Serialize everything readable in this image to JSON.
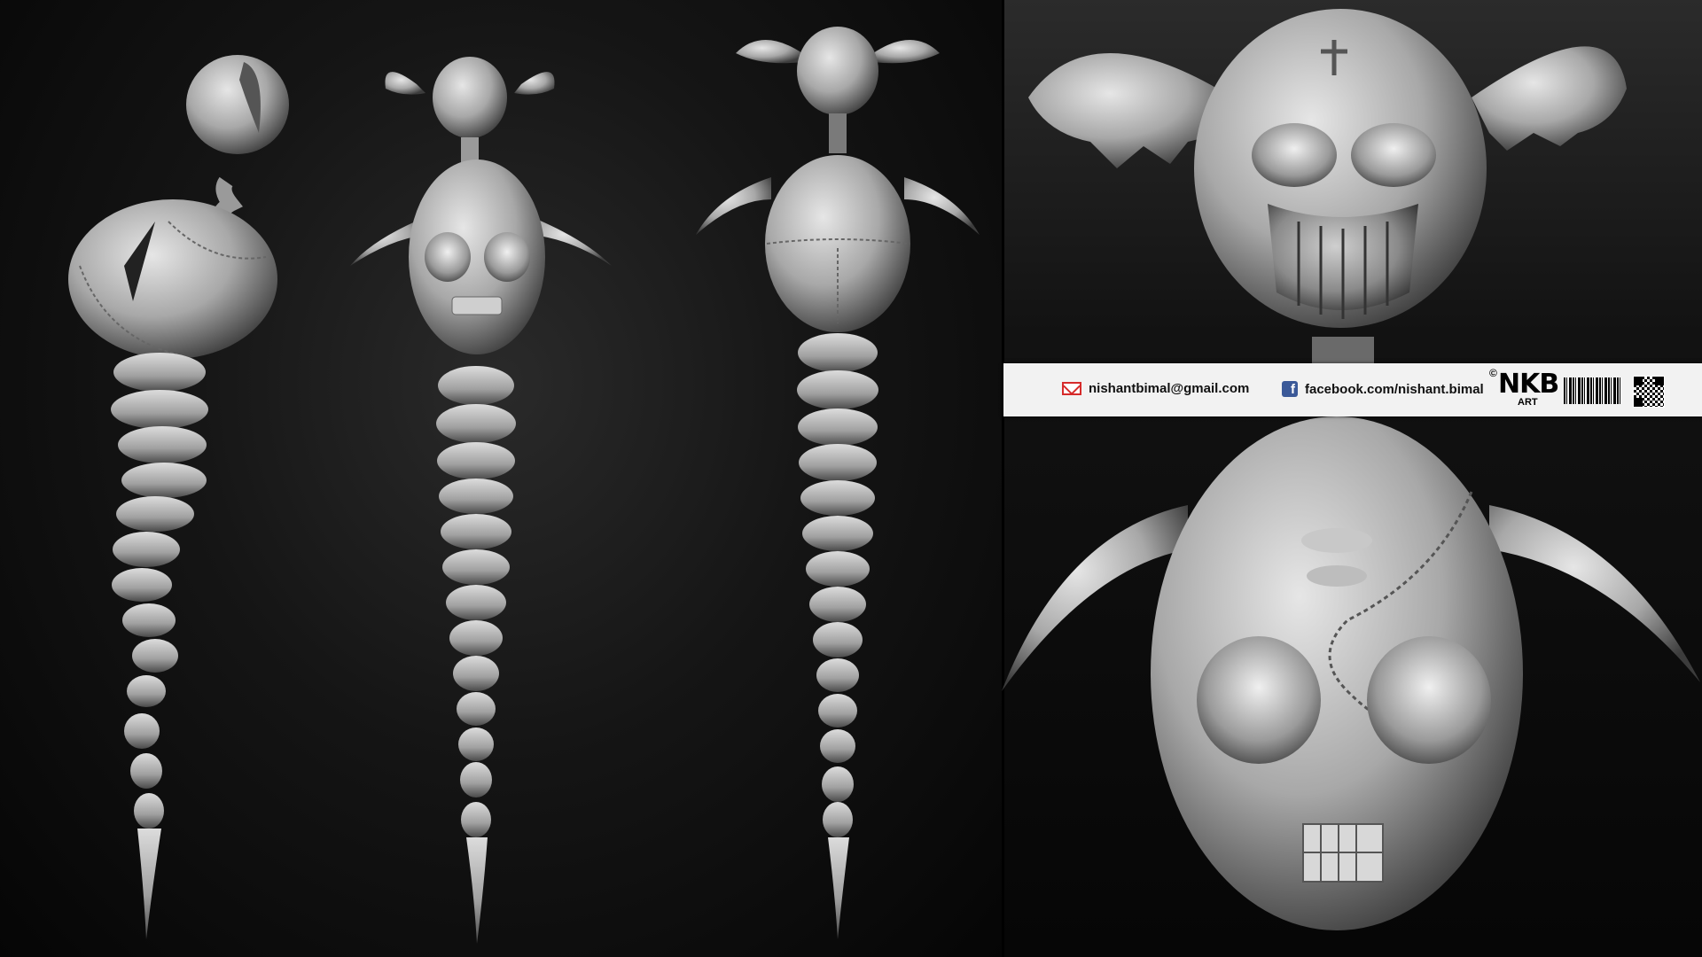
{
  "banner": {
    "email": "nishantbimal@gmail.com",
    "facebook": "facebook.com/nishant.bimal",
    "logo_copyright": "©",
    "logo_mark": "NKB",
    "logo_sub": "ART"
  },
  "icons": {
    "email": "mail-icon",
    "facebook": "facebook-icon",
    "barcode": "barcode-graphic",
    "qr": "qr-code-graphic"
  },
  "colors": {
    "background": "#000000",
    "sculpt": "#bdbdbd",
    "banner": "#f2f2f2",
    "mail_red": "#d62b2b",
    "facebook_blue": "#3b5998"
  }
}
